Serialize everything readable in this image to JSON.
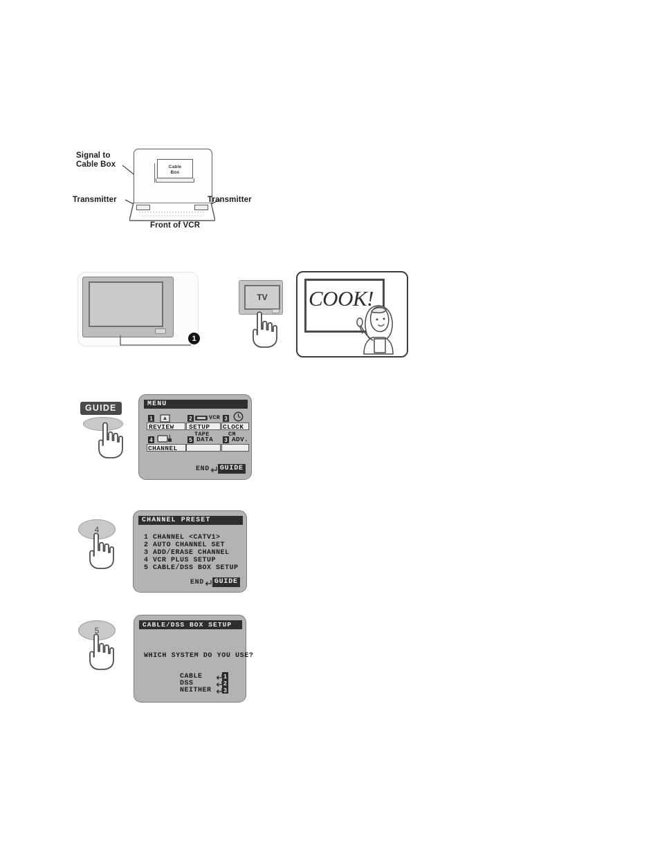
{
  "figure_vcr": {
    "label_signal": "Signal to\nCable Box",
    "label_transmitter_left": "Transmitter",
    "label_transmitter_right": "Transmitter",
    "label_front_of_vcr": "Front of VCR",
    "cable_box_text": "Cable\nBox"
  },
  "step_tv": {
    "step_number": "1",
    "remote_button_label": "TV",
    "cook_text": "COOK!"
  },
  "step_guide": {
    "button_label": "GUIDE",
    "osd": {
      "title": "MENU",
      "cells": [
        {
          "num": "1",
          "label": "REVIEW",
          "side": "",
          "sub": ""
        },
        {
          "num": "2",
          "label": "SETUP",
          "side": "VCR",
          "sub": "TAPE"
        },
        {
          "num": "3",
          "label": "CLOCK",
          "side": "",
          "sub": "CM"
        },
        {
          "num": "4",
          "label": "CHANNEL",
          "side": "",
          "sub": ""
        },
        {
          "num": "5",
          "label": "",
          "side": "DATA",
          "sub": ""
        },
        {
          "num": "3",
          "label": "",
          "side": "ADV.",
          "sub": ""
        }
      ],
      "footer_end": "END",
      "footer_guide": "GUIDE"
    }
  },
  "step_four": {
    "button_label": "4",
    "osd": {
      "title": "CHANNEL PRESET",
      "rows": [
        "1 CHANNEL  <CATV1>",
        "2 AUTO CHANNEL SET",
        "3 ADD/ERASE CHANNEL",
        "4 VCR PLUS SETUP",
        "5 CABLE/DSS BOX SETUP"
      ],
      "footer_end": "END",
      "footer_guide": "GUIDE"
    }
  },
  "step_five": {
    "button_label": "5",
    "osd": {
      "title": "CABLE/DSS BOX SETUP",
      "question": "WHICH SYSTEM DO YOU USE?",
      "options": [
        {
          "label": "CABLE",
          "key": "1"
        },
        {
          "label": "DSS",
          "key": "2"
        },
        {
          "label": "NEITHER",
          "key": "3"
        }
      ]
    }
  },
  "colors": {
    "osd_background": "#b3b3b3",
    "osd_title_bar": "#2e2e2e",
    "ink": "#1f1f1f",
    "page_background": "#ffffff"
  }
}
